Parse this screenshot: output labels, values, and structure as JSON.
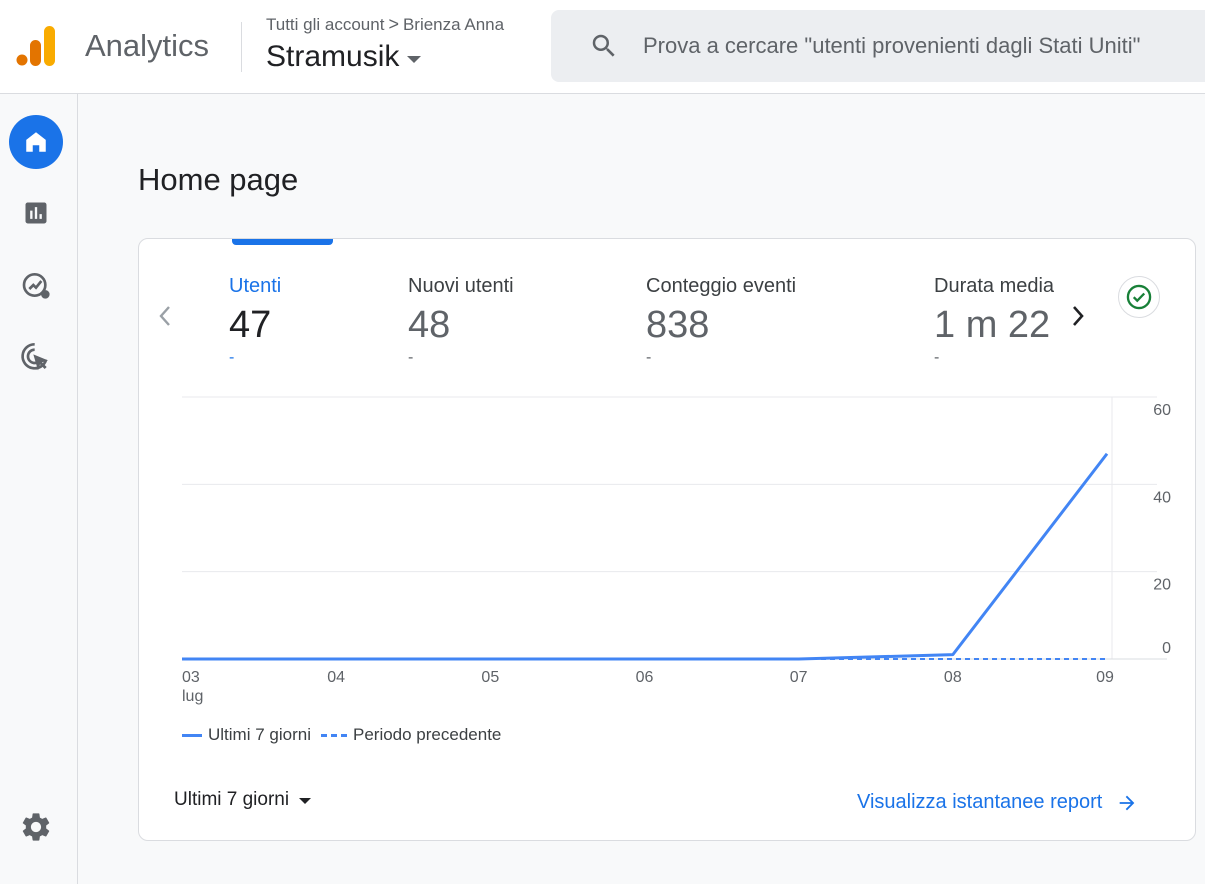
{
  "header": {
    "product_name": "Analytics",
    "breadcrumb": [
      "Tutti gli account",
      "Brienza Anna"
    ],
    "breadcrumb_separator": ">",
    "property_name": "Stramusik",
    "search_placeholder": "Prova a cercare \"utenti provenienti dagli Stati Uniti\""
  },
  "sidenav": {
    "items": [
      {
        "icon": "home-icon",
        "active": true
      },
      {
        "icon": "reports-icon",
        "active": false
      },
      {
        "icon": "explore-icon",
        "active": false
      },
      {
        "icon": "advertising-icon",
        "active": false
      }
    ],
    "settings_icon": "gear-icon"
  },
  "page": {
    "title": "Home page"
  },
  "card": {
    "metrics": [
      {
        "label": "Utenti",
        "value": "47",
        "delta": "-",
        "active": true
      },
      {
        "label": "Nuovi utenti",
        "value": "48",
        "delta": "-",
        "active": false
      },
      {
        "label": "Conteggio eventi",
        "value": "838",
        "delta": "-",
        "active": false
      },
      {
        "label": "Durata media",
        "value": "1 m 22",
        "delta": "-",
        "active": false
      }
    ],
    "legend": {
      "current": "Ultimi 7 giorni",
      "previous": "Periodo precedente"
    },
    "date_range": "Ultimi 7 giorni",
    "report_link": "Visualizza istantanee report",
    "colors": {
      "accent": "#1a73e8",
      "line": "#4285f4",
      "check": "#188038"
    }
  },
  "chart_data": {
    "type": "line",
    "x": [
      "03",
      "04",
      "05",
      "06",
      "07",
      "08",
      "09"
    ],
    "x_sublabel": "lug",
    "series": [
      {
        "name": "Ultimi 7 giorni",
        "values": [
          0,
          0,
          0,
          0,
          0,
          1,
          47
        ]
      },
      {
        "name": "Periodo precedente",
        "values": [
          0,
          0,
          0,
          0,
          0,
          0,
          0
        ]
      }
    ],
    "y_ticks": [
      "60",
      "40",
      "20",
      "0"
    ],
    "ylim": [
      0,
      60
    ],
    "grid": true,
    "legend_position": "bottom-left"
  }
}
